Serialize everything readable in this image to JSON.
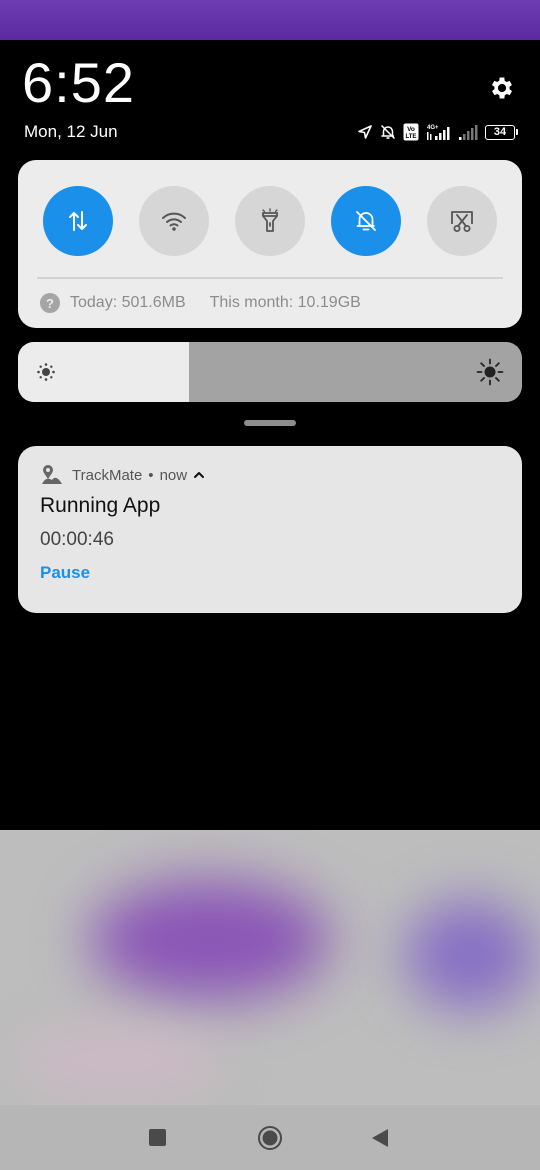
{
  "status": {
    "time": "6:52",
    "date": "Mon, 12 Jun",
    "network": "4G+",
    "volte": "Vo LTE",
    "battery": "34",
    "icons": [
      "location-icon",
      "bell-muted-icon",
      "volte-icon",
      "signal-icon",
      "signal-weak-icon",
      "battery-icon"
    ]
  },
  "quick_settings": {
    "toggles": [
      {
        "name": "mobile-data",
        "icon": "data-arrows-icon",
        "on": true
      },
      {
        "name": "wifi",
        "icon": "wifi-icon",
        "on": false
      },
      {
        "name": "flashlight",
        "icon": "flashlight-icon",
        "on": false
      },
      {
        "name": "silent",
        "icon": "bell-muted-icon",
        "on": true
      },
      {
        "name": "screenshot",
        "icon": "scissors-screenshot-icon",
        "on": false
      }
    ],
    "usage_today": "Today: 501.6MB",
    "usage_month": "This month: 10.19GB",
    "help_glyph": "?"
  },
  "brightness": {
    "level": 0.34
  },
  "notification": {
    "app_name": "TrackMate",
    "separator": "•",
    "time": "now",
    "title": "Running App",
    "text": "00:00:46",
    "action": "Pause"
  },
  "colors": {
    "accent": "#1a90ea",
    "panel": "#ececec",
    "notification_bg": "#e6e6e6"
  }
}
